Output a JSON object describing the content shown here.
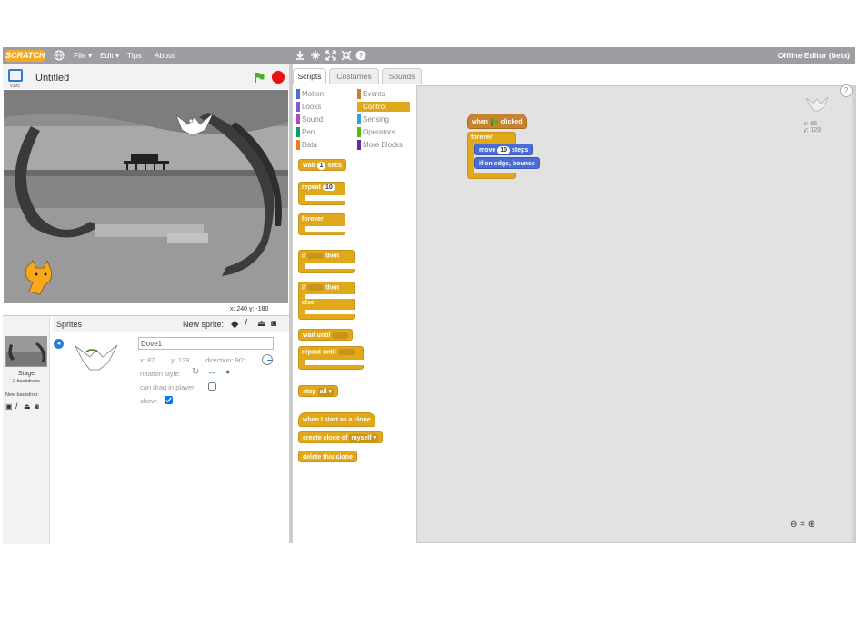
{
  "menubar": {
    "logo": "SCRATCH",
    "items": [
      "File ▾",
      "Edit ▾",
      "Tips",
      "About"
    ],
    "right": "Offline Editor (beta)"
  },
  "stage": {
    "version": "v395",
    "title": "Untitled",
    "coords": "x: 240  y: -180"
  },
  "sprites": {
    "header": "Sprites",
    "new_sprite": "New sprite:",
    "stage_label": "Stage",
    "backdrops": "2 backdrops",
    "new_backdrop": "New backdrop:",
    "name": "Dove1",
    "x_label": "x:",
    "x": "87",
    "y_label": "y:",
    "y": "129",
    "direction_label": "direction:",
    "direction": "90°",
    "rotation_label": "rotation style:",
    "drag_label": "can drag in player:",
    "show_label": "show:"
  },
  "tabs": [
    "Scripts",
    "Costumes",
    "Sounds"
  ],
  "categories_left": [
    {
      "label": "Motion",
      "color": "#4a6cd4"
    },
    {
      "label": "Looks",
      "color": "#8a55d7"
    },
    {
      "label": "Sound",
      "color": "#bb42c3"
    },
    {
      "label": "Pen",
      "color": "#0e9a6c"
    },
    {
      "label": "Data",
      "color": "#ee7d16"
    }
  ],
  "categories_right": [
    {
      "label": "Events",
      "color": "#c88330"
    },
    {
      "label": "Control",
      "color": "#e1a91a"
    },
    {
      "label": "Sensing",
      "color": "#2ca5e2"
    },
    {
      "label": "Operators",
      "color": "#5cb712"
    },
    {
      "label": "More Blocks",
      "color": "#632d99"
    }
  ],
  "palette": {
    "wait_a": "wait",
    "wait_n": "1",
    "wait_b": "secs",
    "repeat": "repeat",
    "repeat_n": "10",
    "forever": "forever",
    "if": "if",
    "then": "then",
    "else": "else",
    "wait_until": "wait until",
    "repeat_until": "repeat until",
    "stop": "stop",
    "stop_opt": "all ▾",
    "clone_start": "when I start as a clone",
    "create_clone": "create clone of",
    "create_clone_opt": "myself ▾",
    "delete_clone": "delete this clone"
  },
  "script": {
    "when": "when",
    "clicked": "clicked",
    "forever": "forever",
    "move": "move",
    "move_n": "10",
    "steps": "steps",
    "bounce": "if on edge, bounce",
    "sprite_x": "x: 86",
    "sprite_y": "y: 129"
  },
  "colors": {
    "control": "#e1a91a",
    "motion": "#4a6cd4",
    "events": "#c88330",
    "menubar": "#9c9ea2"
  }
}
